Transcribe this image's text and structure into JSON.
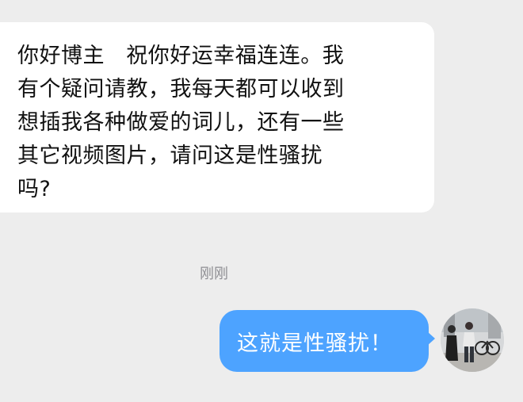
{
  "chat": {
    "incoming_message": "你好博主   祝你好运幸福连连。我\n有个疑问请教，我每天都可以收到\n想插我各种做爱的词儿，还有一些\n其它视频图片，请问这是性骚扰\n吗?",
    "timestamp": "刚刚",
    "outgoing_message": "这就是性骚扰！"
  },
  "colors": {
    "background": "#ededed",
    "incoming_bubble": "#ffffff",
    "outgoing_bubble": "#4da3ff",
    "timestamp_text": "#8e8e93"
  }
}
